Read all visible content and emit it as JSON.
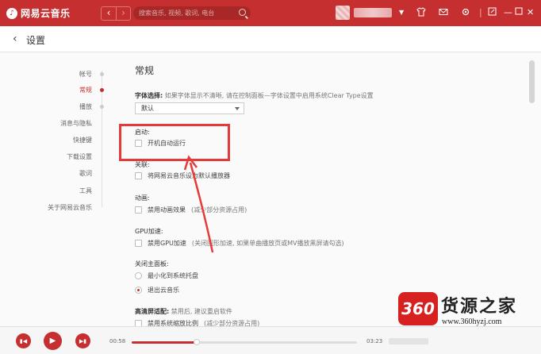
{
  "app": {
    "logo_text": "网易云音乐"
  },
  "topbar": {
    "search_placeholder": "搜索音乐, 视频, 歌词, 电台",
    "icons": [
      "dropdown-arrow",
      "shirt-icon",
      "mail-icon",
      "gear-icon",
      "mini-mode-icon",
      "minimize-icon",
      "maximize-icon",
      "close-icon"
    ]
  },
  "header": {
    "title": "设置"
  },
  "sidebar": {
    "items": [
      {
        "label": "帐号",
        "active": false
      },
      {
        "label": "常规",
        "active": true
      },
      {
        "label": "播放",
        "active": false
      },
      {
        "label": "消息与隐私",
        "active": false
      },
      {
        "label": "快捷键",
        "active": false
      },
      {
        "label": "下载设置",
        "active": false
      },
      {
        "label": "歌词",
        "active": false
      },
      {
        "label": "工具",
        "active": false
      },
      {
        "label": "关于网易云音乐",
        "active": false
      }
    ]
  },
  "main": {
    "section_title": "常规",
    "font": {
      "label": "字体选择:",
      "hint": "如果字体显示不清晰, 请在控制面板—字体设置中启用系统Clear Type设置",
      "selected": "默认"
    },
    "startup": {
      "label": "启动:",
      "option": "开机自动运行"
    },
    "assoc": {
      "label": "关联:",
      "option": "将网易云音乐设为默认播放器"
    },
    "animation": {
      "label": "动画:",
      "option": "禁用动画效果",
      "note": "(减少部分资源占用)"
    },
    "gpu": {
      "label": "GPU加速:",
      "option": "禁用GPU加速",
      "note": "(关闭图形加速, 如果单曲播放页或MV播放黑屏请勾选)"
    },
    "close_panel": {
      "label": "关闭主面板:",
      "option_minimize": "最小化到系统托盘",
      "option_exit": "退出云音乐",
      "selected": "option_exit"
    },
    "hidpi": {
      "label": "高清屏适配:",
      "hint": "禁用后, 建议重启软件",
      "option": "禁用系统缩放比例",
      "note": "(减少部分资源占用)"
    }
  },
  "player": {
    "current_time": "00:58",
    "total_time": "03:23",
    "progress": 0.29
  },
  "watermark": {
    "badge": "360",
    "title": "货源之家",
    "url": "www.360hyzj.com"
  },
  "colors": {
    "accent": "#c62f2f",
    "annotation": "#e63a3a"
  }
}
